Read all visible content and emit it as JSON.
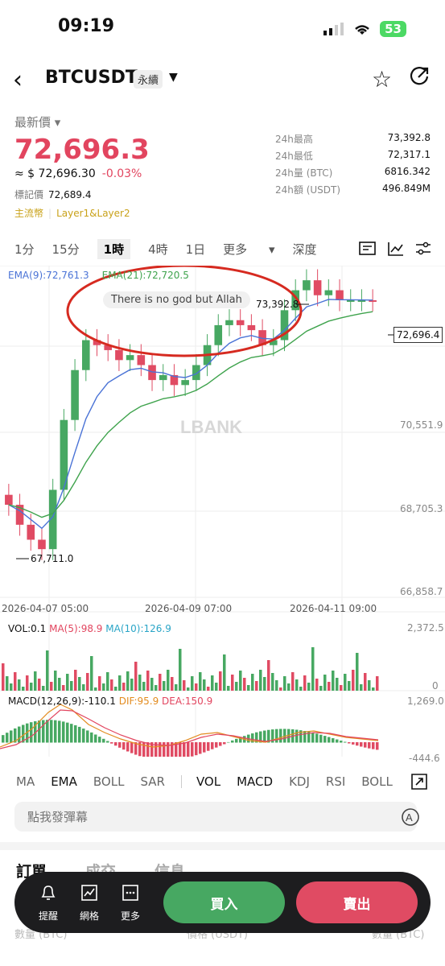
{
  "status": {
    "time": "09:19",
    "battery": "53"
  },
  "header": {
    "title": "BTCUSDT",
    "badge": "永續"
  },
  "price": {
    "latest_label": "最新價",
    "latest": "72,696.3",
    "approx": "≈ $ 72,696.30",
    "change": "-0.03%",
    "mark_label": "標記價",
    "mark_value": "72,689.4",
    "tag1": "主流幣",
    "tag2": "Layer1&Layer2"
  },
  "stats": [
    {
      "k": "24h最高",
      "v": "73,392.8"
    },
    {
      "k": "24h最低",
      "v": "72,317.1"
    },
    {
      "k": "24h量 (BTC)",
      "v": "6816.342"
    },
    {
      "k": "24h額 (USDT)",
      "v": "496.849M"
    }
  ],
  "tabs": [
    "1分",
    "15分",
    "1時",
    "4時",
    "1日",
    "更多",
    "深度"
  ],
  "chart": {
    "ema9": "EMA(9):72,761.3",
    "ema21": "EMA(21):72,720.5",
    "bubble": "There is no god but Allah",
    "high_label": "73,392.8",
    "low_label": "67,711.0",
    "current": "72,696.4",
    "yticks": [
      "70,551.9",
      "68,705.3",
      "66,858.7"
    ],
    "xticks": [
      "2026-04-07 05:00",
      "2026-04-09 07:00",
      "2026-04-11 09:00"
    ],
    "watermark": "LBANK",
    "vol": {
      "label": "VOL:0.1",
      "ma5": "MA(5):98.9",
      "ma10": "MA(10):126.9",
      "max": "2,372.5",
      "zero": "0"
    },
    "macd": {
      "label": "MACD(12,26,9):-110.1",
      "dif": "DIF:95.9",
      "dea": "DEA:150.9",
      "max": "1,269.0",
      "min": "-444.6"
    }
  },
  "chart_data": {
    "type": "candlestick",
    "title": "BTCUSDT 1時",
    "ylim": [
      66858.7,
      73392.8
    ],
    "high": 73392.8,
    "low": 67711.0,
    "last": 72696.4,
    "close_approx": [
      68600,
      68200,
      67900,
      67711,
      68900,
      70300,
      71300,
      71900,
      71800,
      71700,
      71500,
      71600,
      71400,
      71100,
      71200,
      71000,
      71100,
      71400,
      71800,
      72200,
      72300,
      72200,
      72100,
      71800,
      71900,
      72500,
      72900,
      73100,
      72800,
      72900,
      72700,
      72700,
      72700,
      72696
    ]
  },
  "indicators": [
    "MA",
    "EMA",
    "BOLL",
    "SAR",
    "VOL",
    "MACD",
    "KDJ",
    "RSI",
    "BOLL"
  ],
  "danmu_placeholder": "點我發彈幕",
  "order_tabs": [
    "訂單",
    "成交",
    "信息"
  ],
  "columns": [
    "數量 (BTC)",
    "價格 (USDT)",
    "數量 (BTC)"
  ],
  "actions": {
    "alert": "提醒",
    "grid": "網格",
    "more": "更多",
    "buy": "買入",
    "sell": "賣出"
  }
}
